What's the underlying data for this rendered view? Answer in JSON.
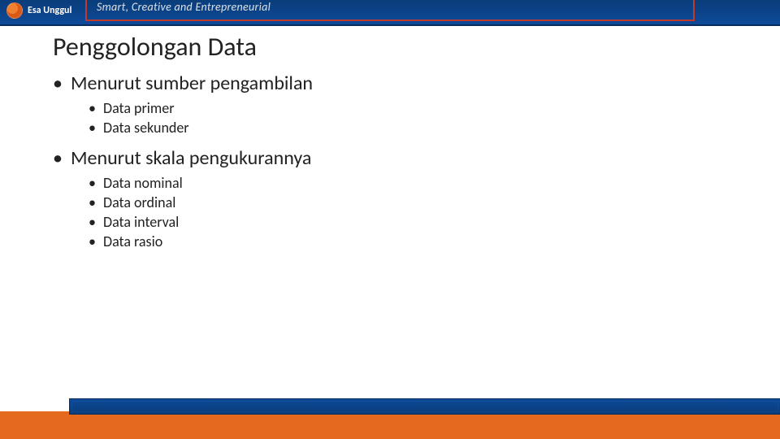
{
  "header": {
    "brand": "Esa Unggul",
    "tagline_fragment": "Smart, Creative and Entrepreneurial"
  },
  "title": "Penggolongan Data",
  "content": {
    "items": [
      {
        "label": "Menurut sumber pengambilan",
        "children": [
          {
            "label": "Data primer"
          },
          {
            "label": "Data sekunder"
          }
        ]
      },
      {
        "label": "Menurut skala pengukurannya",
        "children": [
          {
            "label": "Data nominal"
          },
          {
            "label": "Data ordinal"
          },
          {
            "label": "Data interval"
          },
          {
            "label": "Data rasio"
          }
        ]
      }
    ]
  }
}
